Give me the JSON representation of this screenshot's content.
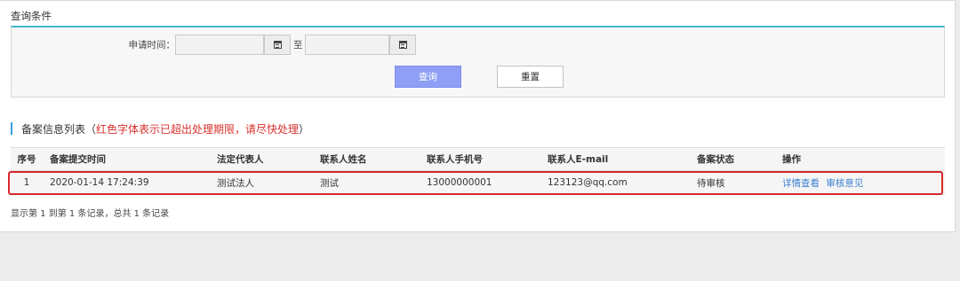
{
  "query": {
    "title": "查询条件",
    "date_label": "申请时间：",
    "to_label": "至",
    "start_value": "",
    "end_value": "",
    "search_label": "查询",
    "reset_label": "重置"
  },
  "list": {
    "title": "备案信息列表（",
    "note": "红色字体表示已超出处理期限，请尽快处理",
    "title_end": "）"
  },
  "table": {
    "headers": [
      "序号",
      "备案提交时间",
      "法定代表人",
      "联系人姓名",
      "联系人手机号",
      "联系人E-mail",
      "备案状态",
      "操作"
    ],
    "rows": [
      {
        "index": "1",
        "submit_time": "2020-01-14 17:24:39",
        "legal_rep": "测试法人",
        "contact_name": "测试",
        "phone": "13000000001",
        "email": "123123@qq.com",
        "status": "待审核",
        "actions": [
          "详情查看",
          "审核意见"
        ]
      }
    ]
  },
  "summary": "显示第 1 到第 1 条记录，总共 1 条记录",
  "colors": {
    "accent_line": "#4bb3cc",
    "search_button": "#8f9ff5",
    "highlight": "#d8282a",
    "warning_text": "#d9302c",
    "link": "#3b7fd0"
  }
}
